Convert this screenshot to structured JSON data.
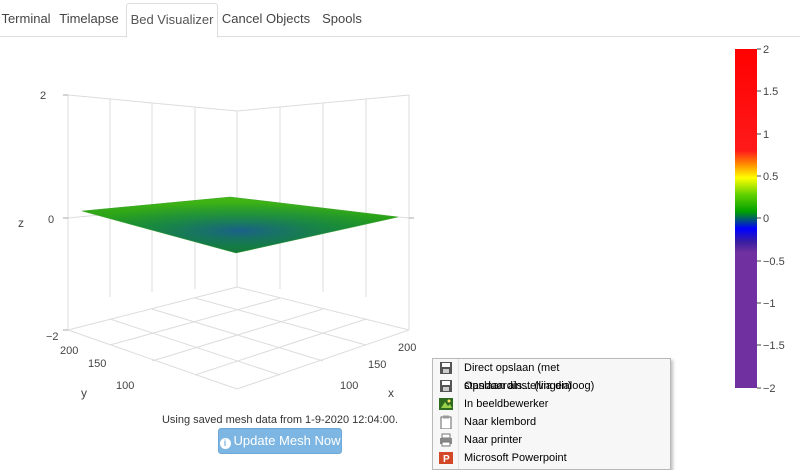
{
  "tabs": [
    {
      "label": "Terminal",
      "active": false
    },
    {
      "label": "Timelapse",
      "active": false
    },
    {
      "label": "Bed Visualizer",
      "active": true
    },
    {
      "label": "Cancel Objects",
      "active": false
    },
    {
      "label": "Spools",
      "active": false
    }
  ],
  "status_text": "Using saved mesh data from 1-9-2020 12:04:00.",
  "update_button": {
    "label": "Update Mesh Now",
    "icon": "info-circle-icon"
  },
  "chart_data": {
    "type": "surface",
    "zlabel": "z",
    "ylabel": "y",
    "xlabel": "x",
    "zlim": [
      -2,
      2
    ],
    "z_ticks": [
      "2",
      "0",
      "−2"
    ],
    "y_ticks": [
      "200",
      "150",
      "100"
    ],
    "x_ticks": [
      "200",
      "150",
      "100"
    ],
    "surface_z_approx": [
      [
        0.05,
        0.0,
        -0.05,
        0.0,
        0.05
      ],
      [
        0.0,
        -0.1,
        -0.15,
        -0.1,
        0.0
      ],
      [
        -0.05,
        -0.15,
        -0.3,
        -0.15,
        -0.05
      ],
      [
        0.0,
        -0.1,
        -0.2,
        -0.1,
        0.0
      ]
    ],
    "colorscale": {
      "range": [
        -2,
        2
      ],
      "ticks": [
        "2",
        "1.5",
        "1",
        "0.5",
        "0",
        "−0.5",
        "−1",
        "−1.5",
        "−2"
      ],
      "colors": {
        "top": "#ff0000",
        "upper": "#ff2020",
        "mid_yellow": "#ffff00",
        "zero_green": "#00b000",
        "minus_blue": "#0000ff",
        "bottom": "#7030a0"
      }
    }
  },
  "context_menu": {
    "items": [
      {
        "label": "Direct opslaan (met standaardinstellingen)",
        "icon": "floppy-disk-icon"
      },
      {
        "label": "Opslaan als... (via dialoog)",
        "icon": "floppy-disk-icon"
      },
      {
        "label": "In beeldbewerker",
        "icon": "image-editor-icon"
      },
      {
        "label": "Naar klembord",
        "icon": "clipboard-icon"
      },
      {
        "label": "Naar printer",
        "icon": "printer-icon"
      },
      {
        "label": "Microsoft Powerpoint",
        "icon": "powerpoint-icon"
      }
    ]
  }
}
